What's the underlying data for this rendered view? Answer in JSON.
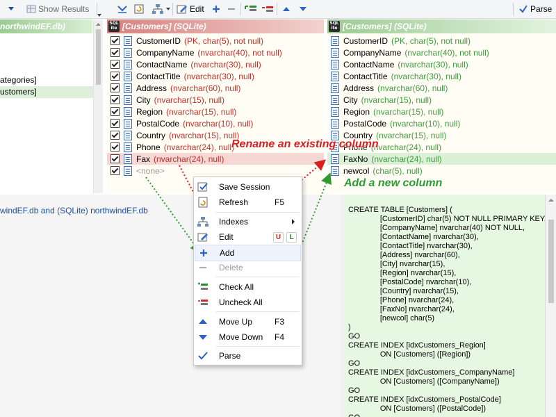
{
  "toolbar": {
    "show_results_label": "Show Results",
    "edit_label": "Edit",
    "parse_label": "Parse"
  },
  "left_panel": {
    "header": "northwindEF.db)",
    "items": [
      {
        "label": "ategories]"
      },
      {
        "label": "ustomers]"
      }
    ]
  },
  "source_table": {
    "header": "[Customers]  (SQLite)",
    "columns": [
      {
        "name": "CustomerID",
        "type": "(PK, char(5), not null)",
        "checked": true
      },
      {
        "name": "CompanyName",
        "type": "(nvarchar(40), not null)",
        "checked": true
      },
      {
        "name": "ContactName",
        "type": "(nvarchar(30), null)",
        "checked": true
      },
      {
        "name": "ContactTitle",
        "type": "(nvarchar(30), null)",
        "checked": true
      },
      {
        "name": "Address",
        "type": "(nvarchar(60), null)",
        "checked": true
      },
      {
        "name": "City",
        "type": "(nvarchar(15), null)",
        "checked": true
      },
      {
        "name": "Region",
        "type": "(nvarchar(15), null)",
        "checked": true
      },
      {
        "name": "PostalCode",
        "type": "(nvarchar(10), null)",
        "checked": true
      },
      {
        "name": "Country",
        "type": "(nvarchar(15), null)",
        "checked": true
      },
      {
        "name": "Phone",
        "type": "(nvarchar(24), null)",
        "checked": true
      },
      {
        "name": "Fax",
        "type": "(nvarchar(24), null)",
        "checked": true
      },
      {
        "name": "<none>",
        "type": "",
        "checked": true
      }
    ]
  },
  "target_table": {
    "header": "[Customers]  (SQLite)",
    "columns": [
      {
        "name": "CustomerID",
        "type": "(PK, char(5), not null)"
      },
      {
        "name": "CompanyName",
        "type": "(nvarchar(40), not null)"
      },
      {
        "name": "ContactName",
        "type": "(nvarchar(30), null)"
      },
      {
        "name": "ContactTitle",
        "type": "(nvarchar(30), null)"
      },
      {
        "name": "Address",
        "type": "(nvarchar(60), null)"
      },
      {
        "name": "City",
        "type": "(nvarchar(15), null)"
      },
      {
        "name": "Region",
        "type": "(nvarchar(15), null)"
      },
      {
        "name": "PostalCode",
        "type": "(nvarchar(10), null)"
      },
      {
        "name": "Country",
        "type": "(nvarchar(15), null)"
      },
      {
        "name": "Phone",
        "type": "(nvarchar(24), null)"
      },
      {
        "name": "FaxNo",
        "type": "(nvarchar(24), null)"
      },
      {
        "name": "newcol",
        "type": "(char(5), null)"
      }
    ]
  },
  "session_path": {
    "left_db": "windEF.db",
    "and_word": "and",
    "right_db": "(SQLite) northwindEF.db"
  },
  "context_menu": {
    "items": [
      {
        "label": "Save Session",
        "shortcut": "",
        "icon": "save-session-icon"
      },
      {
        "label": "Refresh",
        "shortcut": "F5",
        "icon": "refresh-icon"
      },
      {
        "label": "Indexes",
        "shortcut": "",
        "icon": "indexes-icon"
      },
      {
        "label": "Edit",
        "shortcut": "",
        "icon": "edit-icon"
      },
      {
        "label": "Add",
        "shortcut": "",
        "icon": "add-icon"
      },
      {
        "label": "Delete",
        "shortcut": "",
        "icon": "delete-icon"
      },
      {
        "label": "Check All",
        "shortcut": "",
        "icon": "check-all-icon"
      },
      {
        "label": "Uncheck All",
        "shortcut": "",
        "icon": "uncheck-all-icon"
      },
      {
        "label": "Move Up",
        "shortcut": "F3",
        "icon": "move-up-icon"
      },
      {
        "label": "Move Down",
        "shortcut": "F4",
        "icon": "move-down-icon"
      },
      {
        "label": "Parse",
        "shortcut": "",
        "icon": "parse-icon"
      }
    ],
    "edit_badges": {
      "u": "U",
      "l": "L"
    }
  },
  "annotations": {
    "rename": "Rename an existing column",
    "add": "Add a new column"
  },
  "sql_script": "CREATE TABLE [Customers] (\n               [CustomerID] char(5) NOT NULL PRIMARY KEY,\n               [CompanyName] nvarchar(40) NOT NULL,\n               [ContactName] nvarchar(30),\n               [ContactTitle] nvarchar(30),\n               [Address] nvarchar(60),\n               [City] nvarchar(15),\n               [Region] nvarchar(15),\n               [PostalCode] nvarchar(10),\n               [Country] nvarchar(15),\n               [Phone] nvarchar(24),\n               [FaxNo] nvarchar(24),\n               [newcol] char(5)\n)\nGO\nCREATE INDEX [idxCustomers_Region]\n               ON [Customers] ([Region])\nGO\nCREATE INDEX [idxCustomers_CompanyName]\n               ON [Customers] ([CompanyName])\nGO\nCREATE INDEX [idxCustomers_PostalCode]\n               ON [Customers] ([PostalCode])\nGO",
  "colors": {
    "source_accent": "#d6827f",
    "target_accent": "#9ccb93",
    "rename_annotation": "#d81e1e",
    "add_annotation": "#2f9b2f"
  }
}
